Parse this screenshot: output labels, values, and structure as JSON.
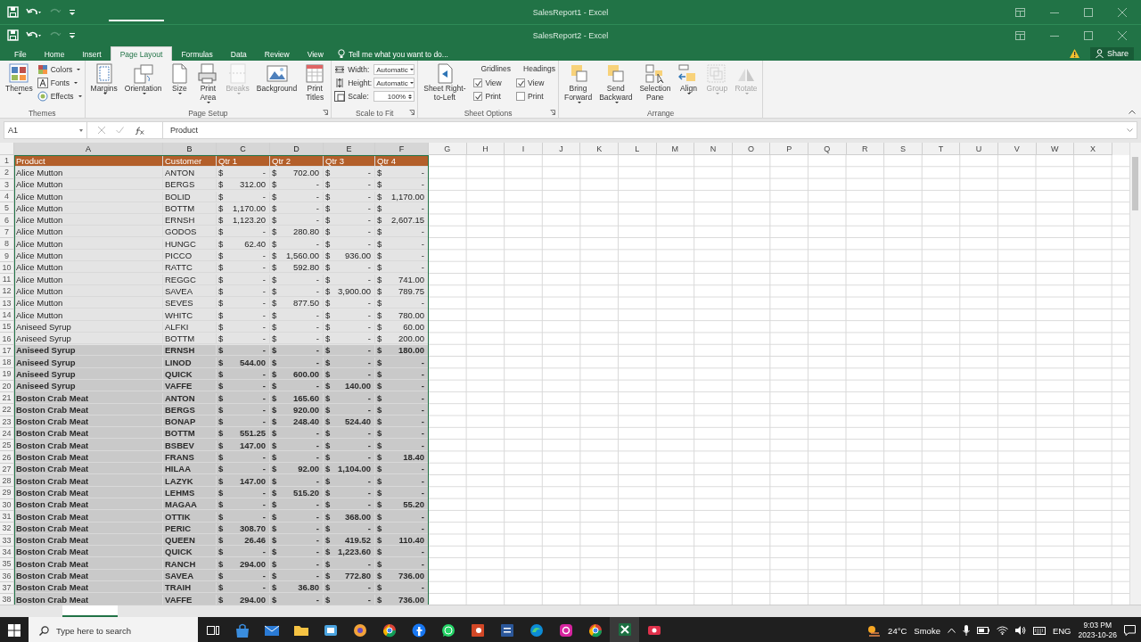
{
  "windows": [
    {
      "title": "SalesReport1 - Excel"
    },
    {
      "title": "SalesReport2 - Excel"
    }
  ],
  "ribbon_tabs": [
    {
      "label": "File",
      "selected": false
    },
    {
      "label": "Home",
      "selected": false
    },
    {
      "label": "Insert",
      "selected": false
    },
    {
      "label": "Page Layout",
      "selected": true
    },
    {
      "label": "Formulas",
      "selected": false
    },
    {
      "label": "Data",
      "selected": false
    },
    {
      "label": "Review",
      "selected": false
    },
    {
      "label": "View",
      "selected": false
    }
  ],
  "tell_me": {
    "placeholder": "Tell me what you want to do..."
  },
  "share_button": "Share",
  "ribbon_groups": [
    {
      "title": "Themes",
      "launcher": false,
      "items": [
        {
          "kind": "large",
          "label": "Themes",
          "dropdown": true,
          "disabled": false
        },
        {
          "kind": "stack",
          "items": [
            {
              "kind": "button",
              "label": "Colors",
              "dropdown": true
            },
            {
              "kind": "button",
              "label": "Fonts",
              "dropdown": true
            },
            {
              "kind": "button",
              "label": "Effects",
              "dropdown": true
            }
          ]
        }
      ]
    },
    {
      "title": "Page Setup",
      "launcher": true,
      "items": [
        {
          "kind": "large",
          "label": "Margins",
          "dropdown": true,
          "disabled": false
        },
        {
          "kind": "large",
          "label": "Orientation",
          "dropdown": true,
          "disabled": false
        },
        {
          "kind": "large",
          "label": "Size",
          "dropdown": true,
          "disabled": false
        },
        {
          "kind": "large",
          "label": "Print\nArea",
          "dropdown": true,
          "disabled": false
        },
        {
          "kind": "large",
          "label": "Breaks",
          "dropdown": true,
          "disabled": true
        },
        {
          "kind": "large",
          "label": "Background",
          "dropdown": false,
          "disabled": false
        },
        {
          "kind": "large",
          "label": "Print\nTitles",
          "dropdown": false,
          "disabled": false
        }
      ]
    },
    {
      "title": "Scale to Fit",
      "launcher": true,
      "items": [
        {
          "kind": "stack",
          "items": [
            {
              "kind": "field",
              "label": "Width:",
              "value": "Automatic"
            },
            {
              "kind": "field",
              "label": "Height:",
              "value": "Automatic"
            },
            {
              "kind": "spin",
              "label": "Scale:",
              "value": "100%"
            }
          ]
        }
      ]
    },
    {
      "title": "Sheet Options",
      "launcher": true,
      "items": [
        {
          "kind": "large",
          "label": "Sheet Right-\nto-Left",
          "dropdown": false,
          "disabled": false
        },
        {
          "kind": "stack",
          "items": [
            {
              "kind": "heading",
              "label": "Gridlines"
            },
            {
              "kind": "check",
              "label": "View",
              "checked": true
            },
            {
              "kind": "check",
              "label": "Print",
              "checked": true
            }
          ]
        },
        {
          "kind": "stack",
          "items": [
            {
              "kind": "heading",
              "label": "Headings"
            },
            {
              "kind": "check",
              "label": "View",
              "checked": true
            },
            {
              "kind": "check",
              "label": "Print",
              "checked": false
            }
          ]
        }
      ]
    },
    {
      "title": "Arrange",
      "launcher": false,
      "items": [
        {
          "kind": "large",
          "label": "Bring\nForward",
          "dropdown": true,
          "disabled": false
        },
        {
          "kind": "large",
          "label": "Send\nBackward",
          "dropdown": true,
          "disabled": false
        },
        {
          "kind": "large",
          "label": "Selection\nPane",
          "dropdown": false,
          "disabled": false
        },
        {
          "kind": "large",
          "label": "Align",
          "dropdown": true,
          "disabled": false
        },
        {
          "kind": "large",
          "label": "Group",
          "dropdown": true,
          "disabled": true
        },
        {
          "kind": "large",
          "label": "Rotate",
          "dropdown": true,
          "disabled": true
        }
      ]
    }
  ],
  "formula_bar": {
    "name_box": "A1",
    "formula": "Product"
  },
  "sheet": {
    "columns": [
      {
        "label": "A",
        "selected": true
      },
      {
        "label": "B",
        "selected": true
      },
      {
        "label": "C",
        "selected": true
      },
      {
        "label": "D",
        "selected": true
      },
      {
        "label": "E",
        "selected": true
      },
      {
        "label": "F",
        "selected": true
      },
      {
        "label": "G",
        "selected": false
      },
      {
        "label": "H",
        "selected": false
      },
      {
        "label": "I",
        "selected": false
      },
      {
        "label": "J",
        "selected": false
      },
      {
        "label": "K",
        "selected": false
      },
      {
        "label": "L",
        "selected": false
      },
      {
        "label": "M",
        "selected": false
      },
      {
        "label": "N",
        "selected": false
      },
      {
        "label": "O",
        "selected": false
      },
      {
        "label": "P",
        "selected": false
      },
      {
        "label": "Q",
        "selected": false
      },
      {
        "label": "R",
        "selected": false
      },
      {
        "label": "S",
        "selected": false
      },
      {
        "label": "T",
        "selected": false
      },
      {
        "label": "U",
        "selected": false
      },
      {
        "label": "V",
        "selected": false
      },
      {
        "label": "W",
        "selected": false
      },
      {
        "label": "X",
        "selected": false
      }
    ],
    "header": {
      "num": "1",
      "cells": [
        "Product",
        "Customer",
        "Qtr 1",
        "Qtr 2",
        "Qtr 3",
        "Qtr 4"
      ]
    },
    "rows": [
      {
        "num": "2",
        "highlighted": false,
        "product": "Alice Mutton",
        "customer": "ANTON",
        "q": [
          [
            "$",
            "-"
          ],
          [
            "$",
            "702.00"
          ],
          [
            "$",
            "-"
          ],
          [
            "$",
            "-"
          ]
        ]
      },
      {
        "num": "3",
        "highlighted": false,
        "product": "Alice Mutton",
        "customer": "BERGS",
        "q": [
          [
            "$",
            "312.00"
          ],
          [
            "$",
            "-"
          ],
          [
            "$",
            "-"
          ],
          [
            "$",
            "-"
          ]
        ]
      },
      {
        "num": "4",
        "highlighted": false,
        "product": "Alice Mutton",
        "customer": "BOLID",
        "q": [
          [
            "$",
            "-"
          ],
          [
            "$",
            "-"
          ],
          [
            "$",
            "-"
          ],
          [
            "$",
            "1,170.00"
          ]
        ]
      },
      {
        "num": "5",
        "highlighted": false,
        "product": "Alice Mutton",
        "customer": "BOTTM",
        "q": [
          [
            "$",
            "1,170.00"
          ],
          [
            "$",
            "-"
          ],
          [
            "$",
            "-"
          ],
          [
            "$",
            "-"
          ]
        ]
      },
      {
        "num": "6",
        "highlighted": false,
        "product": "Alice Mutton",
        "customer": "ERNSH",
        "q": [
          [
            "$",
            "1,123.20"
          ],
          [
            "$",
            "-"
          ],
          [
            "$",
            "-"
          ],
          [
            "$",
            "2,607.15"
          ]
        ]
      },
      {
        "num": "7",
        "highlighted": false,
        "product": "Alice Mutton",
        "customer": "GODOS",
        "q": [
          [
            "$",
            "-"
          ],
          [
            "$",
            "280.80"
          ],
          [
            "$",
            "-"
          ],
          [
            "$",
            "-"
          ]
        ]
      },
      {
        "num": "8",
        "highlighted": false,
        "product": "Alice Mutton",
        "customer": "HUNGC",
        "q": [
          [
            "$",
            "62.40"
          ],
          [
            "$",
            "-"
          ],
          [
            "$",
            "-"
          ],
          [
            "$",
            "-"
          ]
        ]
      },
      {
        "num": "9",
        "highlighted": false,
        "product": "Alice Mutton",
        "customer": "PICCO",
        "q": [
          [
            "$",
            "-"
          ],
          [
            "$",
            "1,560.00"
          ],
          [
            "$",
            "936.00"
          ],
          [
            "$",
            "-"
          ]
        ]
      },
      {
        "num": "10",
        "highlighted": false,
        "product": "Alice Mutton",
        "customer": "RATTC",
        "q": [
          [
            "$",
            "-"
          ],
          [
            "$",
            "592.80"
          ],
          [
            "$",
            "-"
          ],
          [
            "$",
            "-"
          ]
        ]
      },
      {
        "num": "11",
        "highlighted": false,
        "product": "Alice Mutton",
        "customer": "REGGC",
        "q": [
          [
            "$",
            "-"
          ],
          [
            "$",
            "-"
          ],
          [
            "$",
            "-"
          ],
          [
            "$",
            "741.00"
          ]
        ]
      },
      {
        "num": "12",
        "highlighted": false,
        "product": "Alice Mutton",
        "customer": "SAVEA",
        "q": [
          [
            "$",
            "-"
          ],
          [
            "$",
            "-"
          ],
          [
            "$",
            "3,900.00"
          ],
          [
            "$",
            "789.75"
          ]
        ]
      },
      {
        "num": "13",
        "highlighted": false,
        "product": "Alice Mutton",
        "customer": "SEVES",
        "q": [
          [
            "$",
            "-"
          ],
          [
            "$",
            "877.50"
          ],
          [
            "$",
            "-"
          ],
          [
            "$",
            "-"
          ]
        ]
      },
      {
        "num": "14",
        "highlighted": false,
        "product": "Alice Mutton",
        "customer": "WHITC",
        "q": [
          [
            "$",
            "-"
          ],
          [
            "$",
            "-"
          ],
          [
            "$",
            "-"
          ],
          [
            "$",
            "780.00"
          ]
        ]
      },
      {
        "num": "15",
        "highlighted": false,
        "product": "Aniseed Syrup",
        "customer": "ALFKI",
        "q": [
          [
            "$",
            "-"
          ],
          [
            "$",
            "-"
          ],
          [
            "$",
            "-"
          ],
          [
            "$",
            "60.00"
          ]
        ]
      },
      {
        "num": "16",
        "highlighted": false,
        "product": "Aniseed Syrup",
        "customer": "BOTTM",
        "q": [
          [
            "$",
            "-"
          ],
          [
            "$",
            "-"
          ],
          [
            "$",
            "-"
          ],
          [
            "$",
            "200.00"
          ]
        ]
      },
      {
        "num": "17",
        "highlighted": true,
        "product": "Aniseed Syrup",
        "customer": "ERNSH",
        "q": [
          [
            "$",
            "-"
          ],
          [
            "$",
            "-"
          ],
          [
            "$",
            "-"
          ],
          [
            "$",
            "180.00"
          ]
        ]
      },
      {
        "num": "18",
        "highlighted": true,
        "product": "Aniseed Syrup",
        "customer": "LINOD",
        "q": [
          [
            "$",
            "544.00"
          ],
          [
            "$",
            "-"
          ],
          [
            "$",
            "-"
          ],
          [
            "$",
            "-"
          ]
        ]
      },
      {
        "num": "19",
        "highlighted": true,
        "product": "Aniseed Syrup",
        "customer": "QUICK",
        "q": [
          [
            "$",
            "-"
          ],
          [
            "$",
            "600.00"
          ],
          [
            "$",
            "-"
          ],
          [
            "$",
            "-"
          ]
        ]
      },
      {
        "num": "20",
        "highlighted": true,
        "product": "Aniseed Syrup",
        "customer": "VAFFE",
        "q": [
          [
            "$",
            "-"
          ],
          [
            "$",
            "-"
          ],
          [
            "$",
            "140.00"
          ],
          [
            "$",
            "-"
          ]
        ]
      },
      {
        "num": "21",
        "highlighted": true,
        "product": "Boston Crab Meat",
        "customer": "ANTON",
        "q": [
          [
            "$",
            "-"
          ],
          [
            "$",
            "165.60"
          ],
          [
            "$",
            "-"
          ],
          [
            "$",
            "-"
          ]
        ]
      },
      {
        "num": "22",
        "highlighted": true,
        "product": "Boston Crab Meat",
        "customer": "BERGS",
        "q": [
          [
            "$",
            "-"
          ],
          [
            "$",
            "920.00"
          ],
          [
            "$",
            "-"
          ],
          [
            "$",
            "-"
          ]
        ]
      },
      {
        "num": "23",
        "highlighted": true,
        "product": "Boston Crab Meat",
        "customer": "BONAP",
        "q": [
          [
            "$",
            "-"
          ],
          [
            "$",
            "248.40"
          ],
          [
            "$",
            "524.40"
          ],
          [
            "$",
            "-"
          ]
        ]
      },
      {
        "num": "24",
        "highlighted": true,
        "product": "Boston Crab Meat",
        "customer": "BOTTM",
        "q": [
          [
            "$",
            "551.25"
          ],
          [
            "$",
            "-"
          ],
          [
            "$",
            "-"
          ],
          [
            "$",
            "-"
          ]
        ]
      },
      {
        "num": "25",
        "highlighted": true,
        "product": "Boston Crab Meat",
        "customer": "BSBEV",
        "q": [
          [
            "$",
            "147.00"
          ],
          [
            "$",
            "-"
          ],
          [
            "$",
            "-"
          ],
          [
            "$",
            "-"
          ]
        ]
      },
      {
        "num": "26",
        "highlighted": true,
        "product": "Boston Crab Meat",
        "customer": "FRANS",
        "q": [
          [
            "$",
            "-"
          ],
          [
            "$",
            "-"
          ],
          [
            "$",
            "-"
          ],
          [
            "$",
            "18.40"
          ]
        ]
      },
      {
        "num": "27",
        "highlighted": true,
        "product": "Boston Crab Meat",
        "customer": "HILAA",
        "q": [
          [
            "$",
            "-"
          ],
          [
            "$",
            "92.00"
          ],
          [
            "$",
            "1,104.00"
          ],
          [
            "$",
            "-"
          ]
        ]
      },
      {
        "num": "28",
        "highlighted": true,
        "product": "Boston Crab Meat",
        "customer": "LAZYK",
        "q": [
          [
            "$",
            "147.00"
          ],
          [
            "$",
            "-"
          ],
          [
            "$",
            "-"
          ],
          [
            "$",
            "-"
          ]
        ]
      },
      {
        "num": "29",
        "highlighted": true,
        "product": "Boston Crab Meat",
        "customer": "LEHMS",
        "q": [
          [
            "$",
            "-"
          ],
          [
            "$",
            "515.20"
          ],
          [
            "$",
            "-"
          ],
          [
            "$",
            "-"
          ]
        ]
      },
      {
        "num": "30",
        "highlighted": true,
        "product": "Boston Crab Meat",
        "customer": "MAGAA",
        "q": [
          [
            "$",
            "-"
          ],
          [
            "$",
            "-"
          ],
          [
            "$",
            "-"
          ],
          [
            "$",
            "55.20"
          ]
        ]
      },
      {
        "num": "31",
        "highlighted": true,
        "product": "Boston Crab Meat",
        "customer": "OTTIK",
        "q": [
          [
            "$",
            "-"
          ],
          [
            "$",
            "-"
          ],
          [
            "$",
            "368.00"
          ],
          [
            "$",
            "-"
          ]
        ]
      },
      {
        "num": "32",
        "highlighted": true,
        "product": "Boston Crab Meat",
        "customer": "PERIC",
        "q": [
          [
            "$",
            "308.70"
          ],
          [
            "$",
            "-"
          ],
          [
            "$",
            "-"
          ],
          [
            "$",
            "-"
          ]
        ]
      },
      {
        "num": "33",
        "highlighted": true,
        "product": "Boston Crab Meat",
        "customer": "QUEEN",
        "q": [
          [
            "$",
            "26.46"
          ],
          [
            "$",
            "-"
          ],
          [
            "$",
            "419.52"
          ],
          [
            "$",
            "110.40"
          ]
        ]
      },
      {
        "num": "34",
        "highlighted": true,
        "product": "Boston Crab Meat",
        "customer": "QUICK",
        "q": [
          [
            "$",
            "-"
          ],
          [
            "$",
            "-"
          ],
          [
            "$",
            "1,223.60"
          ],
          [
            "$",
            "-"
          ]
        ]
      },
      {
        "num": "35",
        "highlighted": true,
        "product": "Boston Crab Meat",
        "customer": "RANCH",
        "q": [
          [
            "$",
            "294.00"
          ],
          [
            "$",
            "-"
          ],
          [
            "$",
            "-"
          ],
          [
            "$",
            "-"
          ]
        ]
      },
      {
        "num": "36",
        "highlighted": true,
        "product": "Boston Crab Meat",
        "customer": "SAVEA",
        "q": [
          [
            "$",
            "-"
          ],
          [
            "$",
            "-"
          ],
          [
            "$",
            "772.80"
          ],
          [
            "$",
            "736.00"
          ]
        ]
      },
      {
        "num": "37",
        "highlighted": true,
        "product": "Boston Crab Meat",
        "customer": "TRAIH",
        "q": [
          [
            "$",
            "-"
          ],
          [
            "$",
            "36.80"
          ],
          [
            "$",
            "-"
          ],
          [
            "$",
            "-"
          ]
        ]
      },
      {
        "num": "38",
        "highlighted": true,
        "product": "Boston Crab Meat",
        "customer": "VAFFE",
        "q": [
          [
            "$",
            "294.00"
          ],
          [
            "$",
            "-"
          ],
          [
            "$",
            "-"
          ],
          [
            "$",
            "736.00"
          ]
        ]
      }
    ]
  },
  "taskbar": {
    "search_placeholder": "Type here to search",
    "apps": [
      {
        "active": false
      },
      {
        "active": false
      },
      {
        "active": false
      },
      {
        "active": false
      },
      {
        "active": false
      },
      {
        "active": false
      },
      {
        "active": false
      },
      {
        "active": false
      },
      {
        "active": false
      },
      {
        "active": false
      },
      {
        "active": false
      },
      {
        "active": false
      },
      {
        "active": false
      },
      {
        "active": true
      },
      {
        "active": false
      }
    ],
    "temperature": "24°C",
    "weather": "Smoke",
    "language": "ENG",
    "time": "9:03 PM",
    "date": "2023-10-26"
  }
}
